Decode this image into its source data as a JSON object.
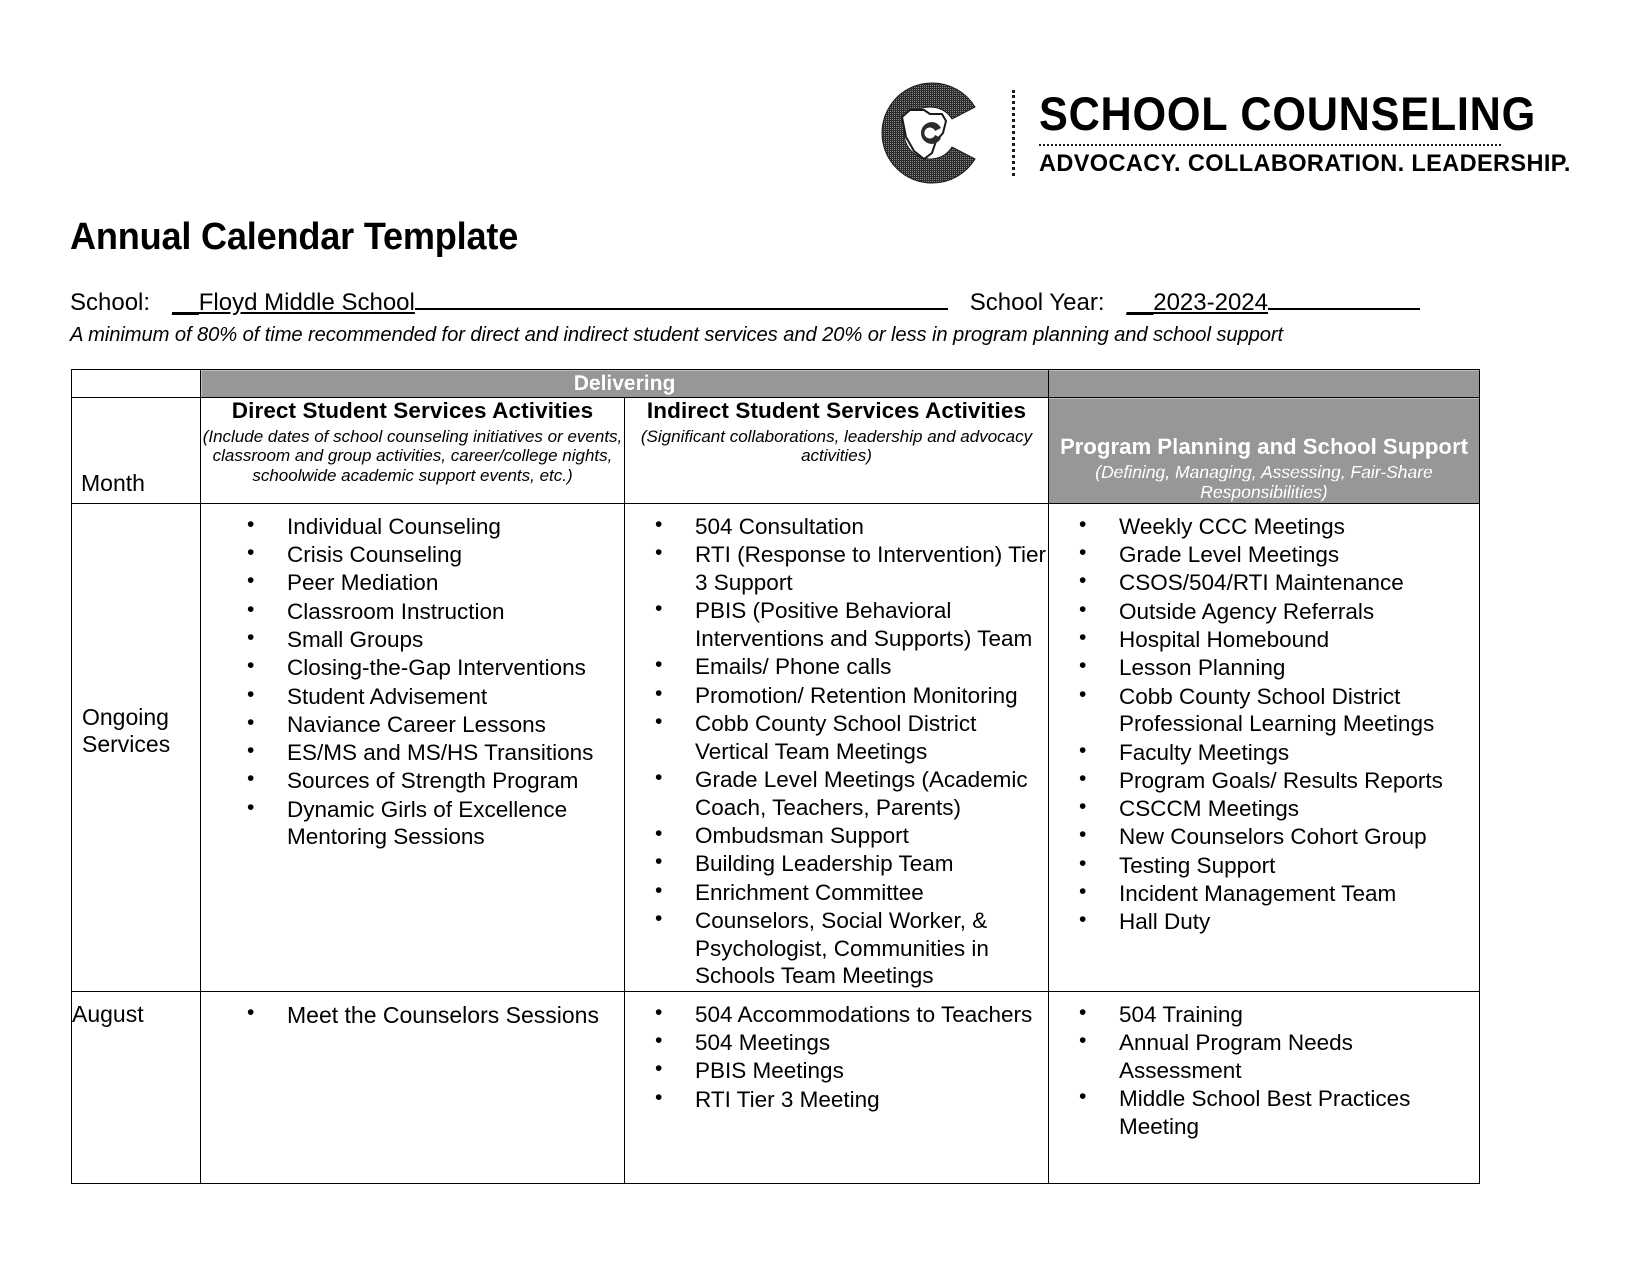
{
  "logo": {
    "mark_icon": "georgia-c-monogram",
    "title": "SCHOOL COUNSELING",
    "subtitle": "ADVOCACY. COLLABORATION. LEADERSHIP."
  },
  "document": {
    "title": "Annual Calendar Template"
  },
  "meta": {
    "school_label": "School:",
    "school_value": "__Floyd Middle School",
    "school_year_label": "School Year:",
    "school_year_value": "__2023-2024",
    "note": "A minimum of 80% of time recommended for direct and indirect student services and 20% or less in program planning and school support"
  },
  "table": {
    "group_header": "Delivering",
    "month_header": "Month",
    "columns": [
      {
        "title": "Direct Student Services Activities",
        "subtitle": "(Include dates of school counseling initiatives or events, classroom and group activities, career/college nights, schoolwide academic support events, etc.)"
      },
      {
        "title": "Indirect Student Services Activities",
        "subtitle": "(Significant collaborations, leadership and advocacy activities)"
      },
      {
        "title": "Program Planning and School Support",
        "subtitle": "(Defining, Managing, Assessing, Fair-Share Responsibilities)"
      }
    ],
    "rows": [
      {
        "month": "Ongoing Services",
        "month_line1": "Ongoing",
        "month_line2": "Services",
        "direct": [
          "Individual Counseling",
          "Crisis Counseling",
          "Peer Mediation",
          "Classroom Instruction",
          "Small Groups",
          "Closing-the-Gap Interventions",
          "Student Advisement",
          "Naviance Career Lessons",
          "ES/MS and MS/HS Transitions",
          "Sources of Strength Program",
          "Dynamic Girls of Excellence Mentoring Sessions"
        ],
        "indirect": [
          "504 Consultation",
          "RTI (Response to Intervention) Tier 3 Support",
          "PBIS (Positive Behavioral Interventions and Supports) Team",
          "Emails/ Phone calls",
          "Promotion/ Retention Monitoring",
          "Cobb County School District Vertical Team Meetings",
          "Grade Level Meetings (Academic Coach, Teachers, Parents)",
          "Ombudsman Support",
          "Building Leadership Team",
          "Enrichment Committee",
          "Counselors, Social Worker, & Psychologist, Communities in Schools Team Meetings"
        ],
        "program": [
          "Weekly CCC Meetings",
          "Grade Level Meetings",
          "CSOS/504/RTI Maintenance",
          "Outside Agency Referrals",
          "Hospital Homebound",
          "Lesson Planning",
          "Cobb County School District Professional Learning Meetings",
          "Faculty Meetings",
          "Program Goals/ Results Reports",
          "CSCCM Meetings",
          "New Counselors Cohort Group",
          "Testing Support",
          "Incident Management Team",
          "Hall Duty"
        ]
      },
      {
        "month": "August",
        "month_line1": "August",
        "month_line2": "",
        "direct": [
          "Meet the Counselors Sessions"
        ],
        "indirect": [
          "504 Accommodations to Teachers",
          "504 Meetings",
          "PBIS Meetings",
          "RTI Tier 3 Meeting"
        ],
        "program": [
          "504 Training",
          "Annual Program Needs Assessment",
          "Middle School Best Practices Meeting"
        ]
      }
    ]
  }
}
